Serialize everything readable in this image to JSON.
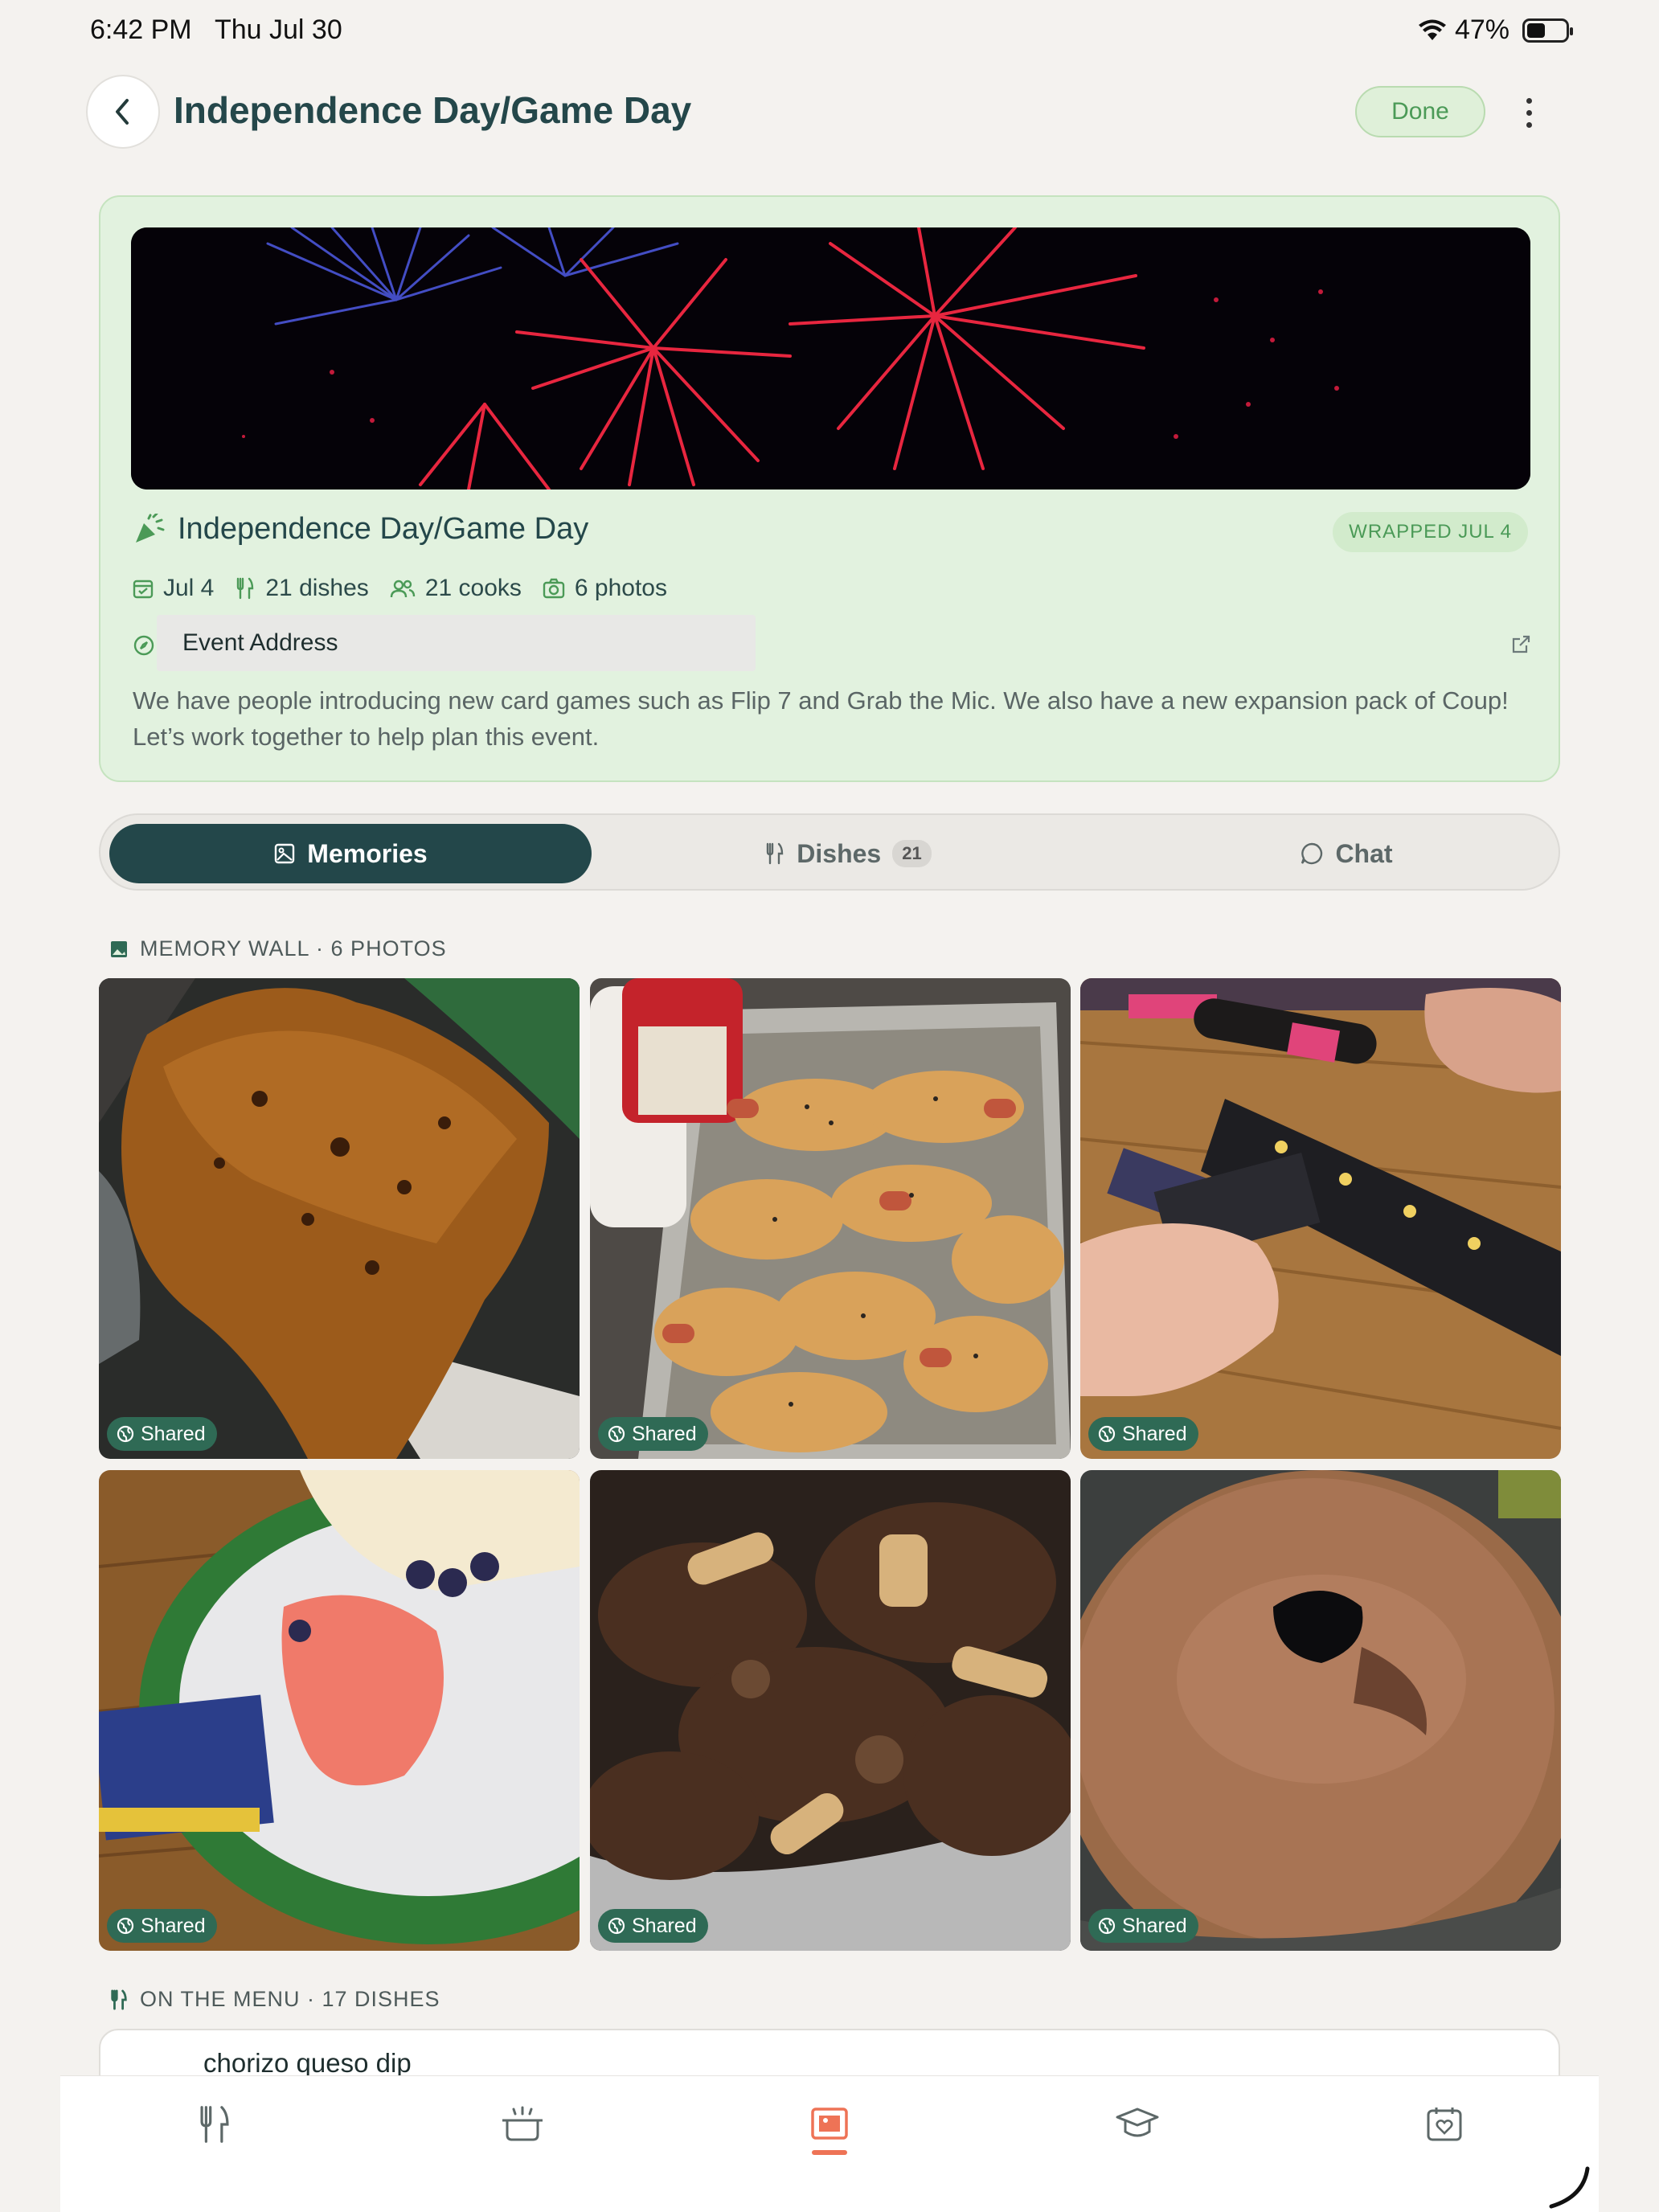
{
  "status_bar": {
    "time": "6:42 PM",
    "date": "Thu Jul 30",
    "battery": "47%"
  },
  "header": {
    "title": "Independence Day/Game Day",
    "done_label": "Done"
  },
  "event": {
    "name": "Independence Day/Game Day",
    "badge": "WRAPPED JUL 4",
    "date": "Jul 4",
    "dishes": "21 dishes",
    "cooks": "21 cooks",
    "photos": "6 photos",
    "address_label": "Event Address",
    "description": "We have people introducing new card games such as Flip 7 and Grab the Mic.  We also have a new expansion pack of Coup!  Let’s work together to help plan this event."
  },
  "tabs": [
    {
      "label": "Memories",
      "icon": "image-icon",
      "active": true
    },
    {
      "label": "Dishes",
      "icon": "utensils-icon",
      "count": "21"
    },
    {
      "label": "Chat",
      "icon": "chat-bubble-icon"
    }
  ],
  "memory_wall": {
    "heading": "MEMORY WALL · 6 PHOTOS",
    "photos": [
      {
        "subject": "rice cake slice",
        "tag": "Shared"
      },
      {
        "subject": "pigs in a blanket tray",
        "tag": "Shared"
      },
      {
        "subject": "card game on table",
        "tag": "Shared"
      },
      {
        "subject": "cake on plate with Phase 10 cards",
        "tag": "Shared"
      },
      {
        "subject": "braised short ribs",
        "tag": "Shared"
      },
      {
        "subject": "bundt cake",
        "tag": "Shared"
      }
    ]
  },
  "menu": {
    "heading": "ON THE MENU · 17 DISHES",
    "first_dish": "chorizo queso dip"
  },
  "bottom_nav": [
    {
      "icon": "utensils-icon"
    },
    {
      "icon": "cooking-pot-icon"
    },
    {
      "icon": "gallery-icon",
      "active": true
    },
    {
      "icon": "graduation-cap-icon"
    },
    {
      "icon": "calendar-heart-icon"
    }
  ],
  "colors": {
    "accent": "#23474a",
    "brand_green": "#4b9a57",
    "active_nav": "#ee7356",
    "card_bg": "#e2f2df"
  }
}
